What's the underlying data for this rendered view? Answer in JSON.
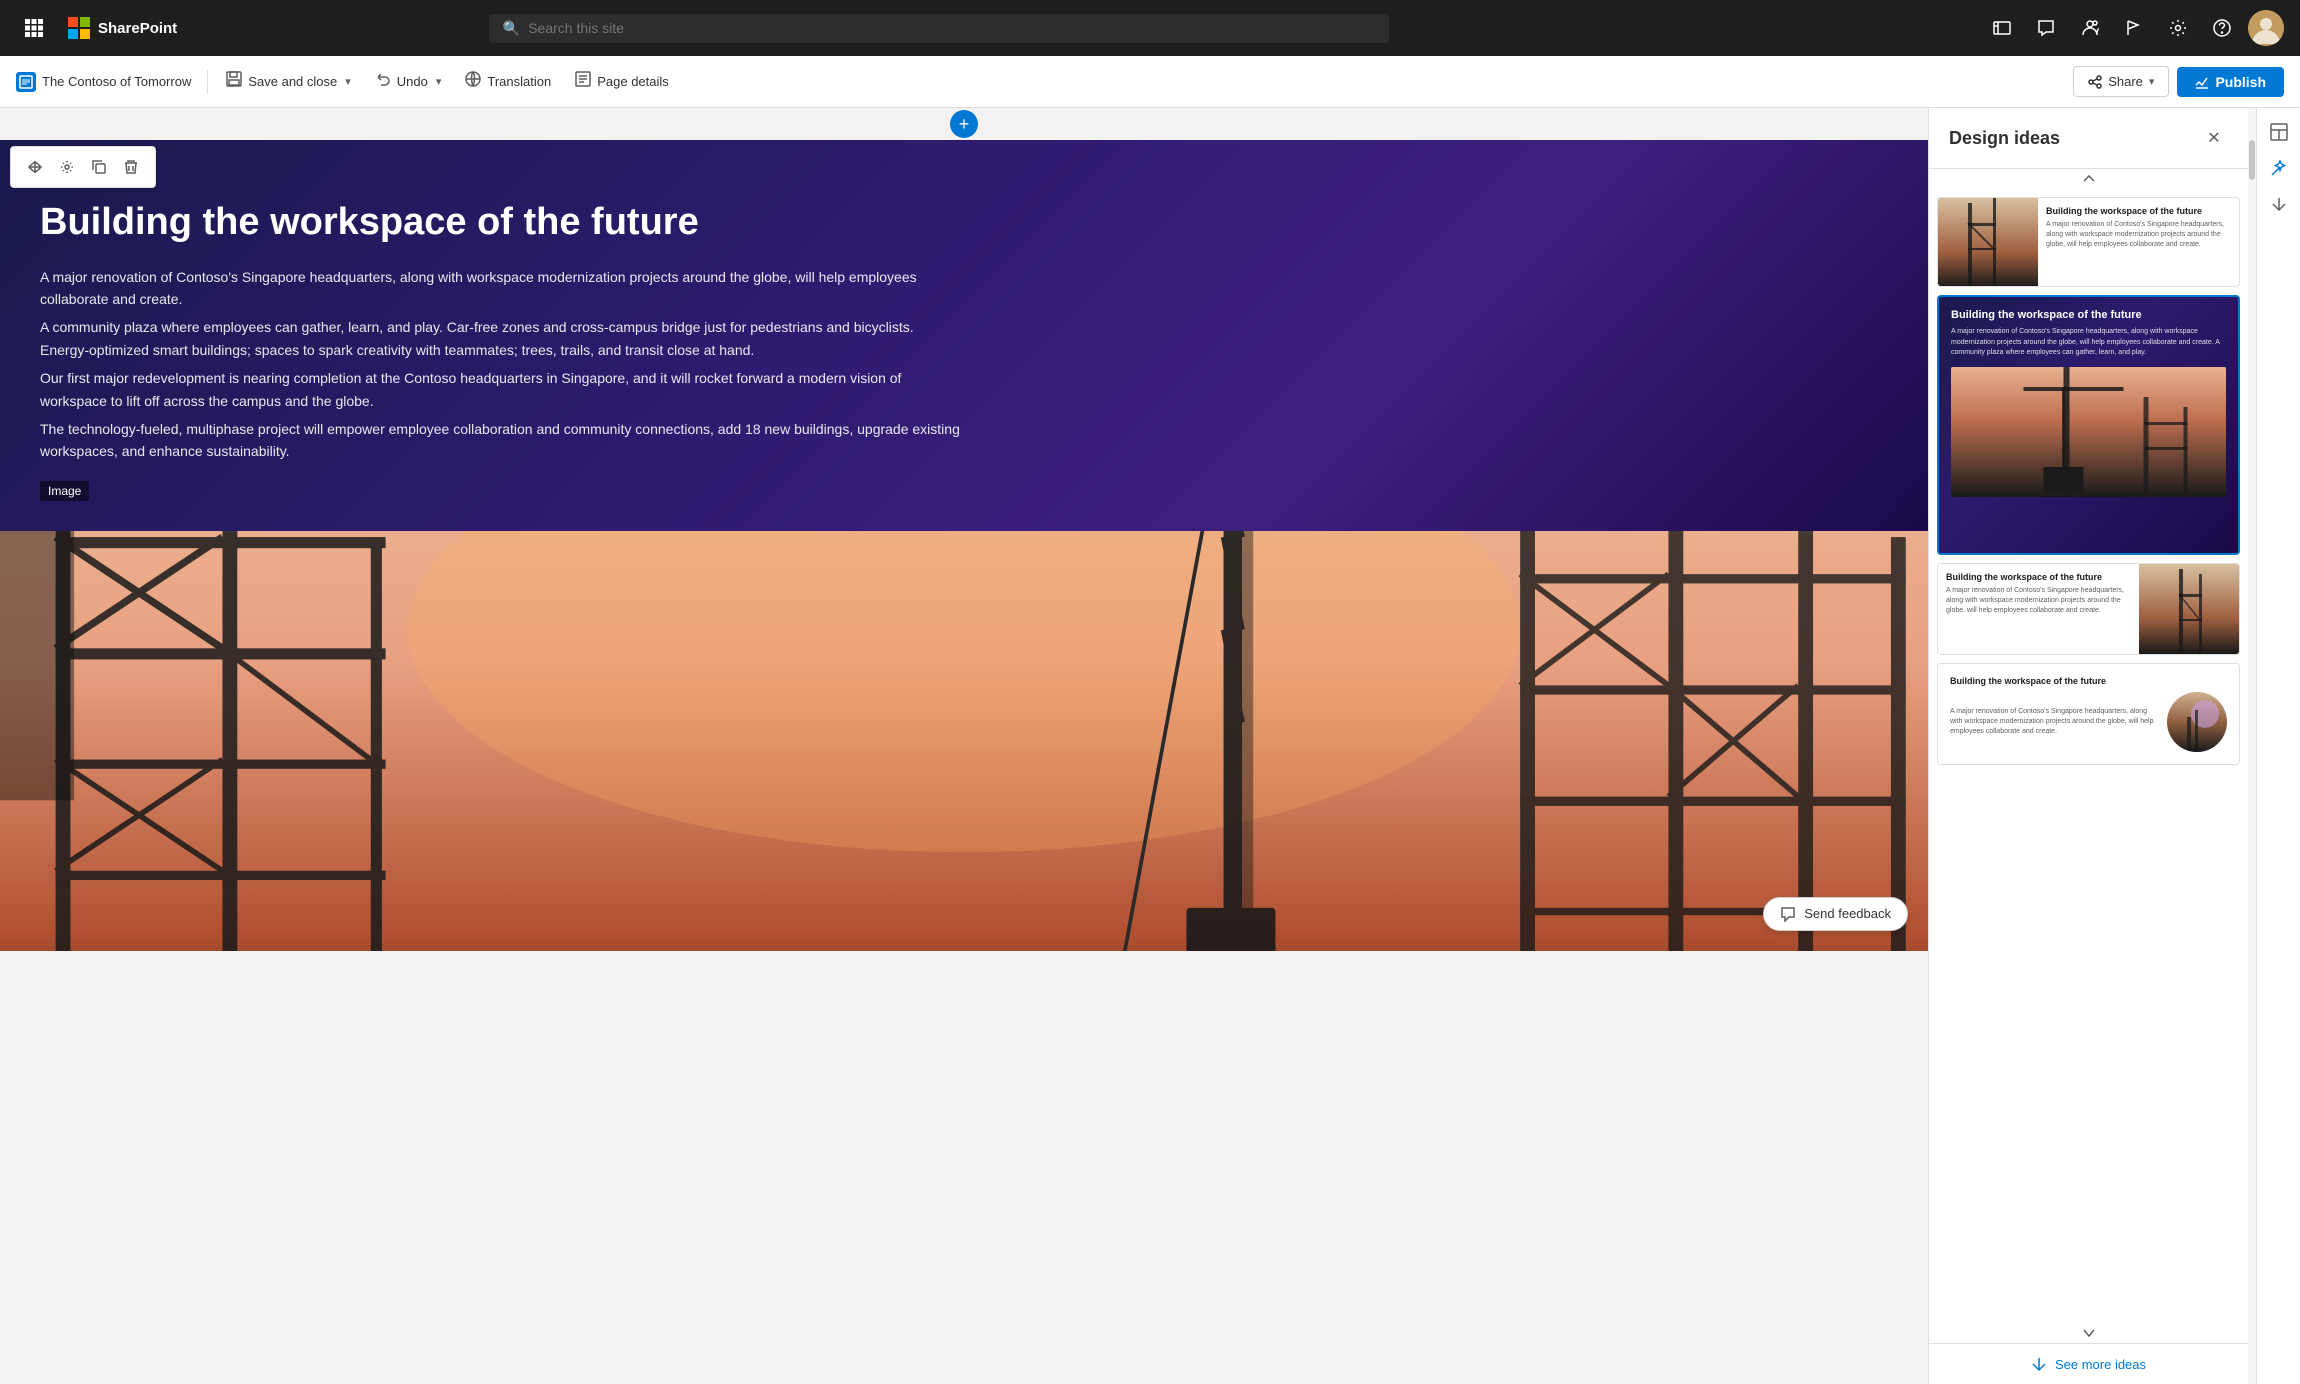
{
  "app": {
    "name": "SharePoint",
    "waffle_icon": "⊞"
  },
  "nav": {
    "search_placeholder": "Search this site",
    "icons": [
      "🌐",
      "💬",
      "👥",
      "🚩",
      "⚙",
      "?"
    ]
  },
  "toolbar": {
    "brand_label": "The Contoso of Tomorrow",
    "save_close_label": "Save and close",
    "undo_label": "Undo",
    "translation_label": "Translation",
    "page_details_label": "Page details",
    "share_label": "Share",
    "publish_label": "Publish"
  },
  "block_tools": [
    "move",
    "settings",
    "duplicate",
    "delete"
  ],
  "hero": {
    "title": "Building the workspace of the future",
    "paragraphs": [
      "A major renovation of Contoso's Singapore headquarters, along with workspace modernization projects around the globe, will help employees collaborate and create.",
      "A community plaza where employees can gather, learn, and play. Car-free zones and cross-campus bridge just for pedestrians and bicyclists. Energy-optimized smart buildings; spaces to spark creativity with teammates; trees, trails, and transit close at hand.",
      "Our first major redevelopment is nearing completion at the Contoso headquarters in Singapore, and it will rocket forward a modern vision of workspace to lift off across the campus and the globe.",
      "The technology-fueled, multiphase project will empower employee collaboration and community connections, add 18 new buildings, upgrade existing workspaces, and enhance sustainability."
    ],
    "image_label": "Image"
  },
  "feedback": {
    "label": "Send feedback"
  },
  "design_panel": {
    "title": "Design ideas",
    "close_label": "×",
    "see_more_label": "See more ideas",
    "card1": {
      "title": "Building the workspace of the future",
      "text": "A major renovation of Contoso's Singapore headquarters, along with workspace modernization projects around the globe, will help employees collaborate and create."
    },
    "card2": {
      "title": "Building the workspace of the future",
      "text": "A major renovation of Contoso's Singapore headquarters, along with workspace modernization projects around the globe, will help employees collaborate and create. A community plaza where employees can gather, learn, and play."
    },
    "card3": {
      "title": "Building the workspace of the future",
      "text": "A major renovation of Contoso's Singapore headquarters, along with workspace modernization projects around the globe, will help employees collaborate and create."
    },
    "card4": {
      "title": "Building the workspace of the future",
      "text": "A major renovation of Contoso's Singapore headquarters, along with workspace modernization projects around the globe, will help employees collaborate and create."
    }
  }
}
